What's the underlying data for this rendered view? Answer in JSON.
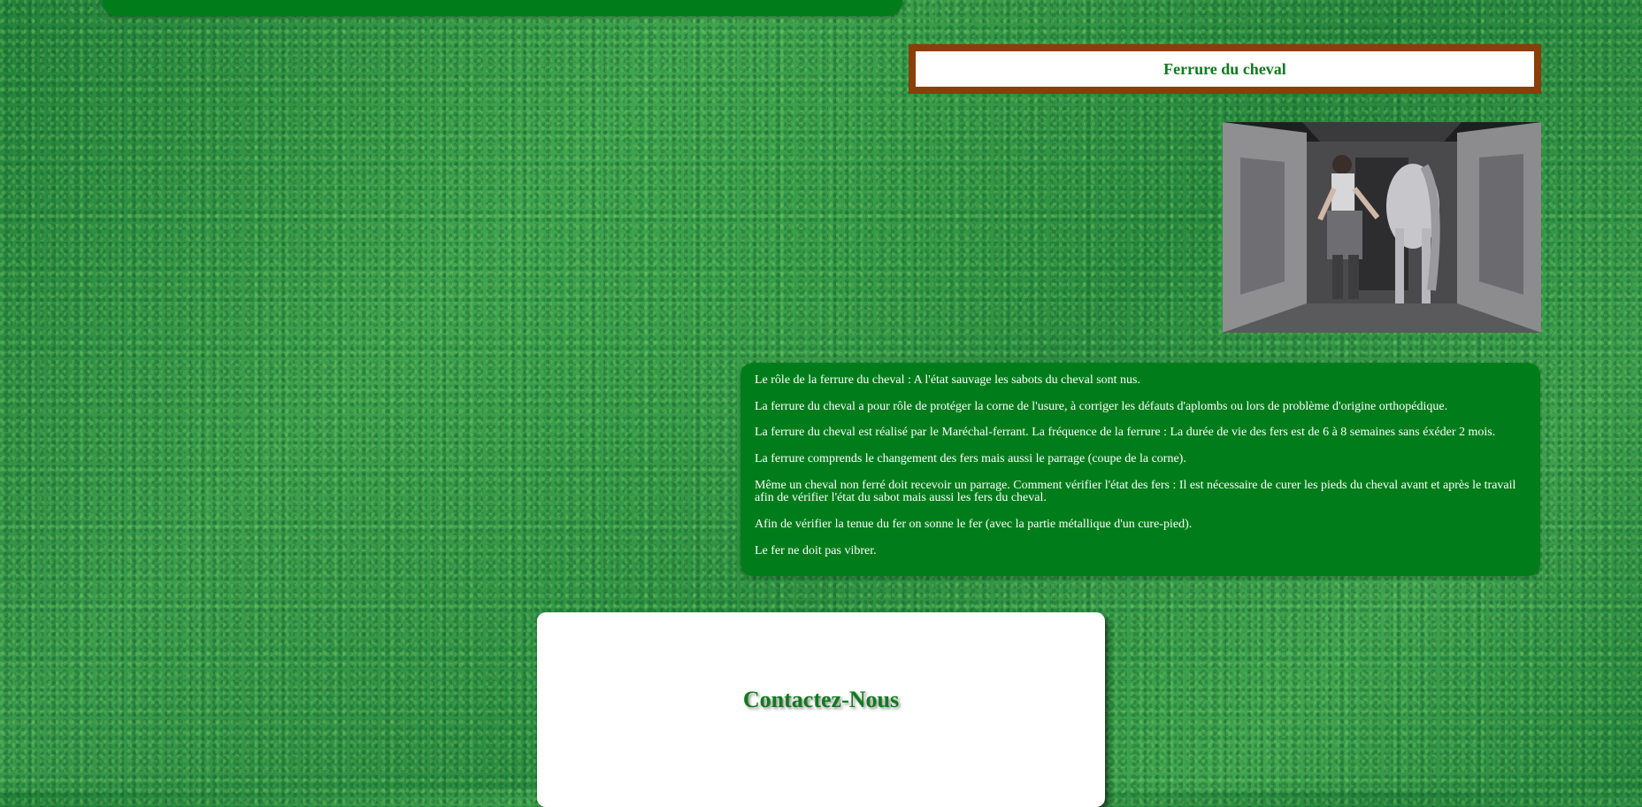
{
  "title_box": {
    "title": "Ferrure du cheval"
  },
  "image": {
    "alt": "Maréchal-ferrant ferrant un cheval dans une écurie"
  },
  "info": {
    "paragraphs": [
      "Le rôle de la ferrure du cheval : A l'état sauvage les sabots du cheval sont nus.",
      "La ferrure du cheval a pour rôle de protéger la corne de l'usure, à corriger les défauts d'aplombs ou lors de problème d'origine orthopédique.",
      "La ferrure du cheval est réalisé par le Maréchal-ferrant. La fréquence de la ferrure : La durée de vie des fers est de 6 à 8 semaines sans éxéder 2 mois.",
      "La ferrure comprends le changement des fers mais aussi le parrage (coupe de la corne).",
      "Même un cheval non ferré doit recevoir un parrage. Comment vérifier l'état des fers : Il est nécessaire de curer les pieds du cheval avant et après le travail afin de vérifier l'état du sabot mais aussi les fers du cheval.",
      "Afin de vérifier la tenue du fer on sonne le fer (avec la partie métallique d'un cure-pied).",
      "Le fer ne doit pas vibrer."
    ]
  },
  "contact": {
    "title": "Contactez-Nous"
  },
  "colors": {
    "card_green": "#007d1a",
    "title_green": "#0f7a1f",
    "frame_brown": "#8a3e0a"
  }
}
